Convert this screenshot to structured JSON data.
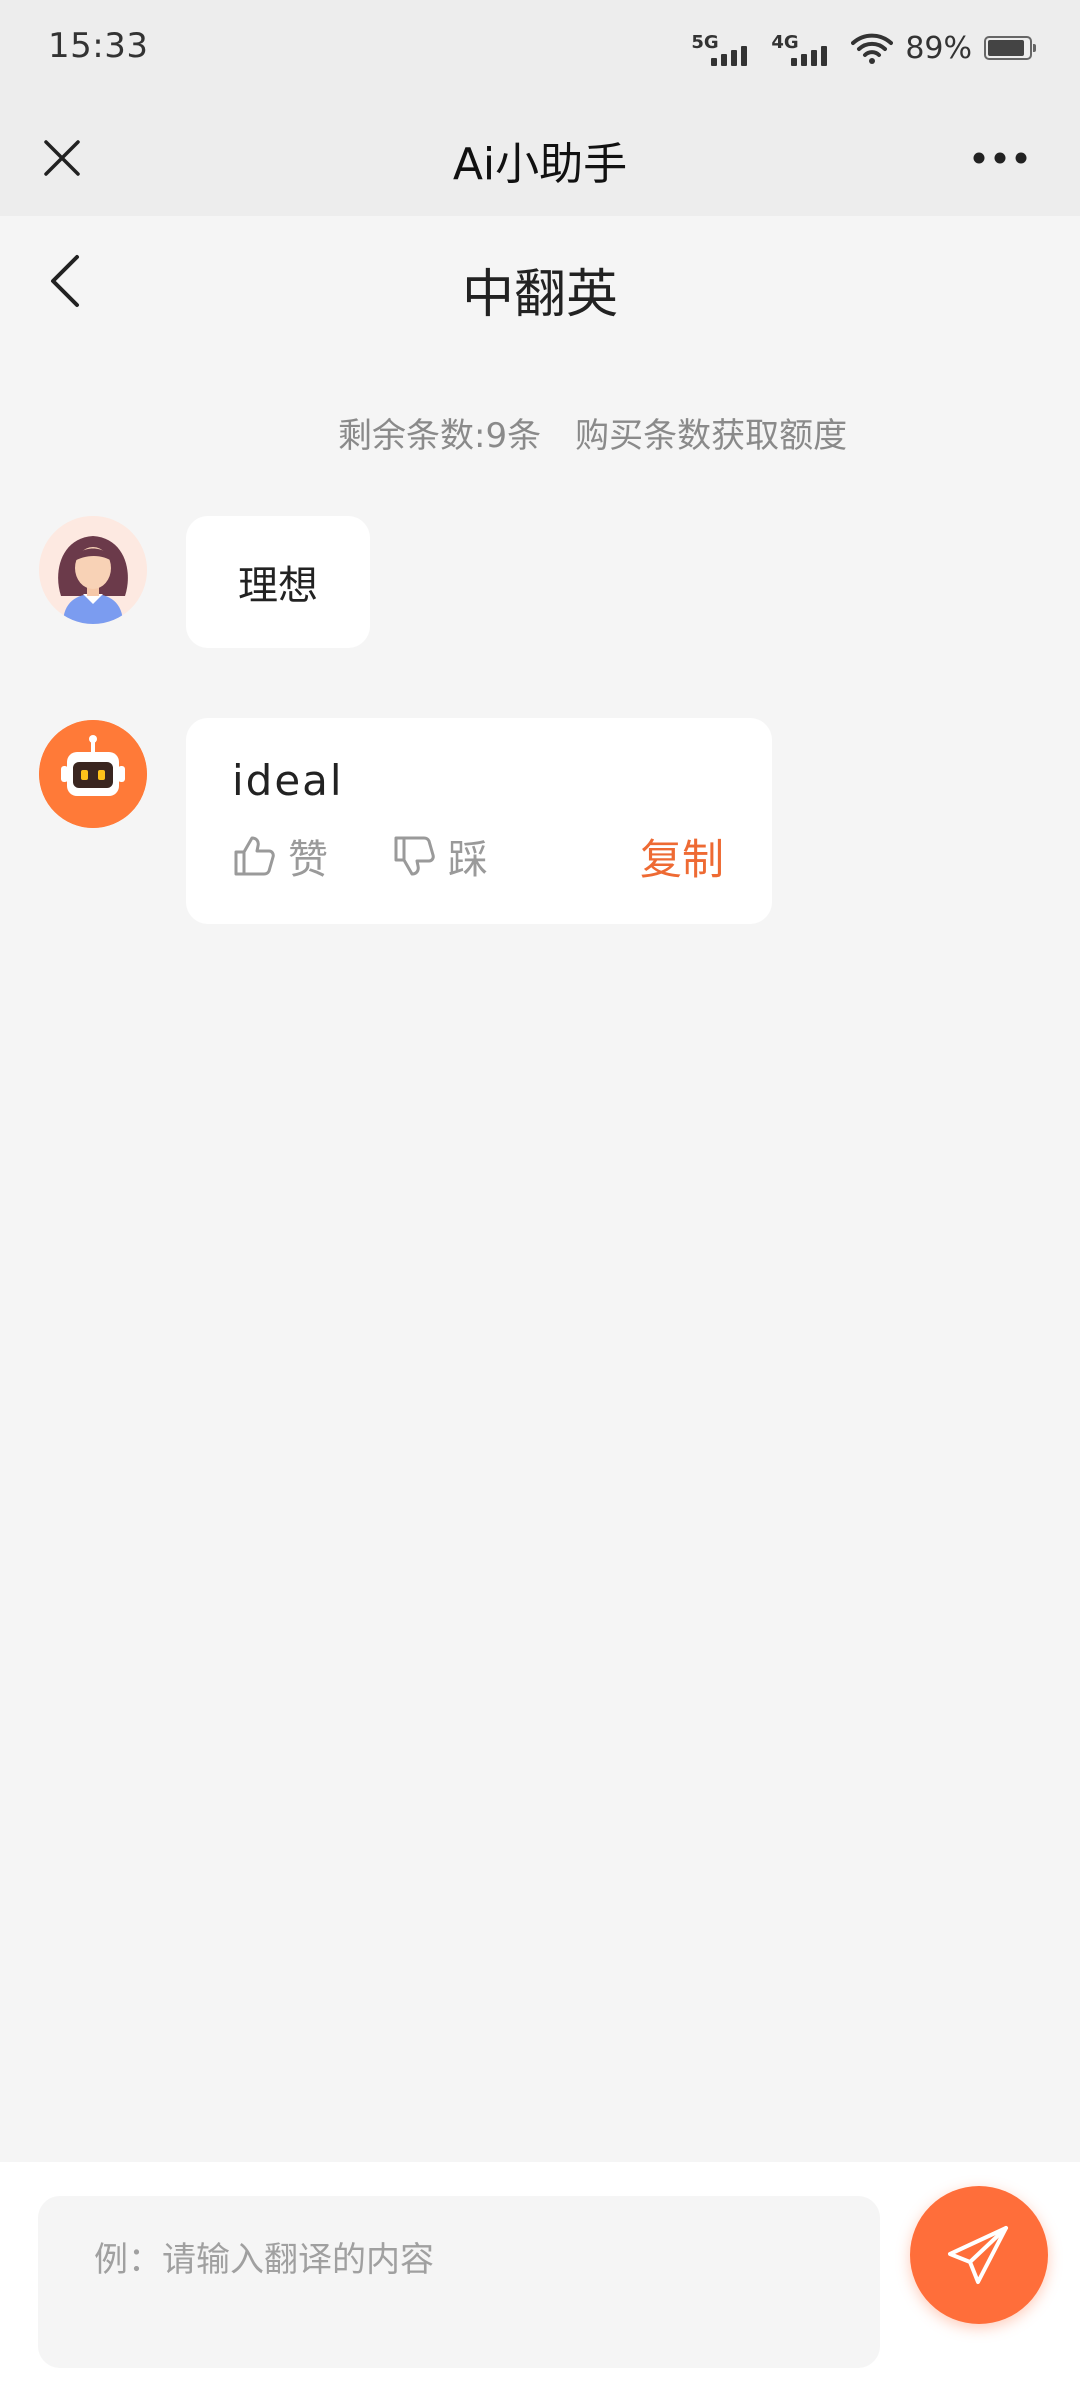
{
  "status_bar": {
    "time": "15:33",
    "network_1": "5G",
    "network_2": "4G",
    "battery_percent": "89%",
    "battery_level": 0.89,
    "icons": [
      "signal-5g-icon",
      "signal-4g-icon",
      "wifi-icon",
      "battery-icon"
    ]
  },
  "app_bar": {
    "title": "Ai小助手",
    "close_icon": "close-icon",
    "more_icon": "more-icon"
  },
  "page": {
    "title": "中翻英",
    "back_icon": "chevron-left-icon"
  },
  "quota": {
    "remaining": "剩余条数:9条",
    "buy": "购买条数获取额度"
  },
  "messages": [
    {
      "role": "user",
      "avatar": "user-avatar",
      "text": "理想"
    },
    {
      "role": "assistant",
      "avatar": "robot-avatar",
      "text": "ideal",
      "actions": {
        "like_label": "赞",
        "dislike_label": "踩",
        "copy_label": "复制"
      }
    }
  ],
  "input": {
    "placeholder": "例：请输入翻译的内容",
    "value": "",
    "send_icon": "send-icon"
  },
  "colors": {
    "accent": "#ff6e3a",
    "copy_text": "#ee6a33",
    "background": "#f5f5f5",
    "header_background": "#ededed",
    "bubble": "#ffffff"
  }
}
